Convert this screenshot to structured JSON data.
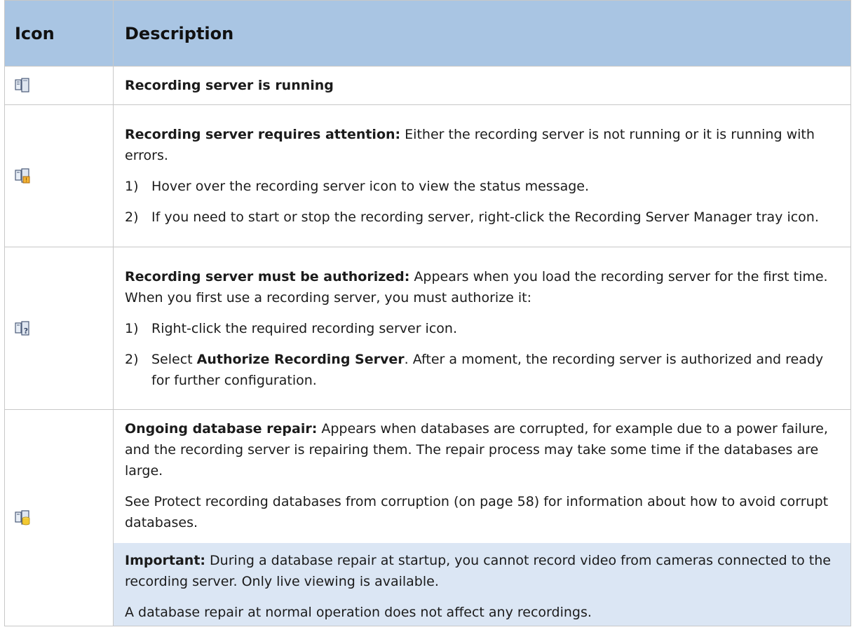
{
  "header": {
    "icon": "Icon",
    "description": "Description"
  },
  "rows": [
    {
      "icon": "server-running-icon",
      "title": "Recording server is running"
    },
    {
      "icon": "server-attention-icon",
      "title": "Recording server requires attention:",
      "text": " Either the recording server is not running or it is running with errors.",
      "steps": [
        {
          "num": "1)",
          "text": "Hover over the recording server icon to view the status message."
        },
        {
          "num": "2)",
          "text": "If you need to start or stop the recording server, right-click the Recording Server Manager tray icon."
        }
      ]
    },
    {
      "icon": "server-unauthorized-icon",
      "title": "Recording server must be authorized:",
      "text": " Appears when you load the recording server for the first time. When you first use a recording server, you must authorize it:",
      "steps": [
        {
          "num": "1)",
          "text": "Right-click the required recording server icon."
        },
        {
          "num": "2)",
          "pre": "Select ",
          "bold": "Authorize Recording Server",
          "text": ". After a moment, the recording server is authorized and ready for further configuration."
        }
      ]
    },
    {
      "icon": "server-database-repair-icon",
      "title": "Ongoing database repair:",
      "text": " Appears when databases are corrupted, for example due to a power failure, and the recording server is repairing them. The repair process may take some time if the databases are large.",
      "see": "See Protect recording databases from corruption (on page 58) for information about how to avoid corrupt databases.",
      "note_title": "Important:",
      "note_text": " During a database repair at startup, you cannot record video from cameras connected to the recording server. Only live viewing is available.",
      "note_extra": "A database repair at normal operation does not affect any recordings."
    }
  ]
}
